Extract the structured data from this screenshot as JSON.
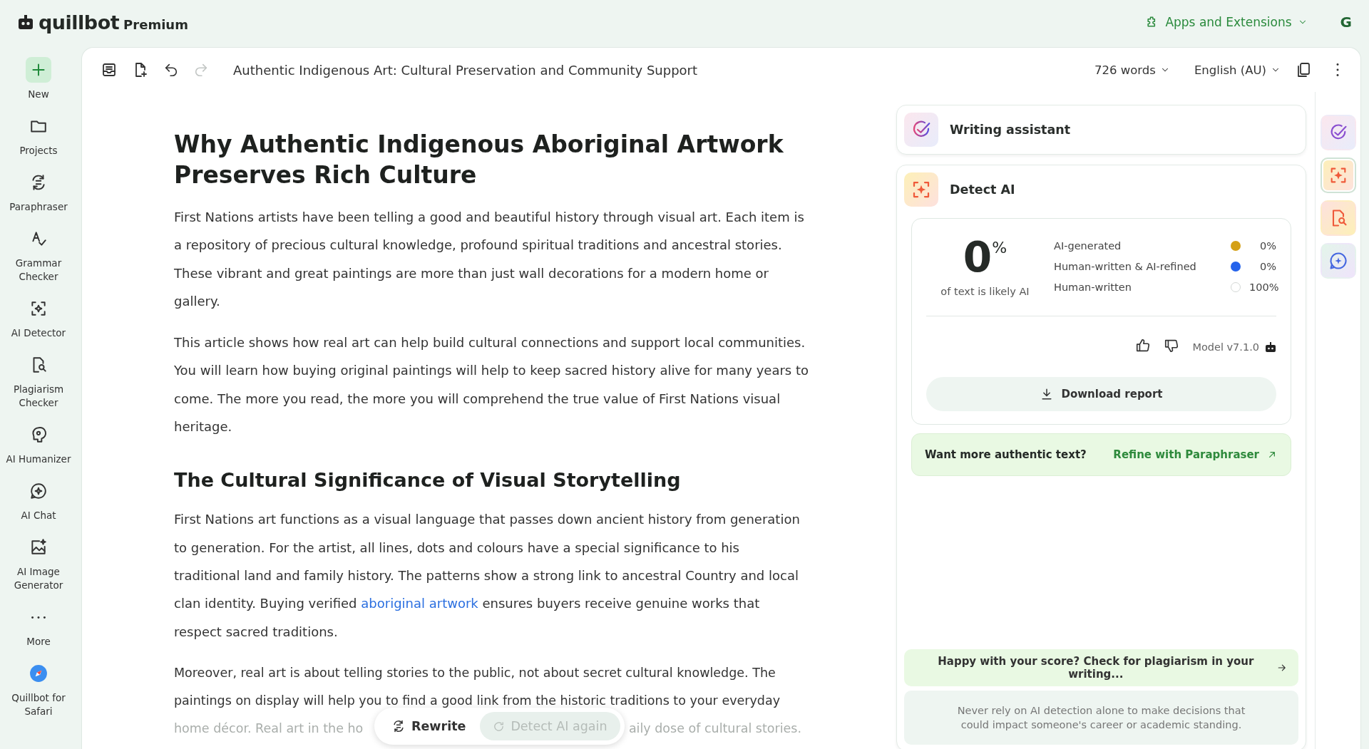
{
  "brand": {
    "name": "quillbot",
    "tier": "Premium"
  },
  "top_actions": {
    "apps_label": "Apps and Extensions",
    "avatar": "G"
  },
  "sidebar": {
    "items": [
      {
        "label": "New",
        "kind": "primary"
      },
      {
        "label": "Projects",
        "kind": "tool"
      },
      {
        "label": "Paraphraser",
        "kind": "tool"
      },
      {
        "label": "Grammar Checker",
        "kind": "tool"
      },
      {
        "label": "AI Detector",
        "kind": "tool"
      },
      {
        "label": "Plagiarism Checker",
        "kind": "tool"
      },
      {
        "label": "AI Humanizer",
        "kind": "tool"
      },
      {
        "label": "AI Chat",
        "kind": "tool"
      },
      {
        "label": "AI Image Generator",
        "kind": "tool"
      },
      {
        "label": "More",
        "kind": "tool"
      },
      {
        "label": "Quillbot for Safari",
        "kind": "app"
      }
    ]
  },
  "editor": {
    "title": "Authentic Indigenous Art: Cultural Preservation and Community Support",
    "word_count": "726 words",
    "language": "English (AU)",
    "redo_disabled": true,
    "blocks": [
      {
        "kind": "h1",
        "text": "Why Authentic Indigenous Aboriginal Artwork Preserves Rich Culture"
      },
      {
        "kind": "p",
        "text": "First Nations artists have been telling a good and beautiful history through visual art. Each item is a repository of precious cultural knowledge, profound spiritual traditions and ancestral stories. These vibrant and great paintings are more than just wall decorations for a modern home or gallery."
      },
      {
        "kind": "p",
        "text": "This article shows how real art can help build cultural connections and support local communities. You will learn how buying original paintings will help to keep sacred history alive for many years to come. The more you read, the more you will comprehend the true value of First Nations visual heritage."
      },
      {
        "kind": "h2",
        "text": "The Cultural Significance of Visual Storytelling"
      },
      {
        "kind": "p_link",
        "before": "First Nations art functions as a visual language that passes down ancient history from generation to generation. For the artist, all lines, dots and colours have a special significance to his traditional land and family history. The patterns show a strong link to ancestral Country and local clan identity. Buying verified ",
        "link": "aboriginal artwork",
        "after": " ensures buyers receive genuine works that respect sacred traditions."
      },
      {
        "kind": "cut",
        "lines": [
          "Moreover, real art is about telling stories to the public, not about secret cultural knowledge. The",
          "paintings on display will help you to find a good link from the historic traditions to your everyday"
        ],
        "faded": [
          "home décor. Real art in the ho",
          "aily dose of cultural stories."
        ]
      }
    ]
  },
  "floating_bar": {
    "rewrite": "Rewrite",
    "detect_again": {
      "label": "Detect AI again",
      "disabled": true
    }
  },
  "panel": {
    "writing_assistant": "Writing assistant",
    "detect_title": "Detect AI",
    "score": {
      "value": "0",
      "unit": "%",
      "caption": "of text is likely AI"
    },
    "breakdown": [
      {
        "label": "AI-generated",
        "color": "#d4a017",
        "value": "0%"
      },
      {
        "label": "Human-written & AI-refined",
        "color": "#2563eb",
        "value": "0%"
      },
      {
        "label": "Human-written",
        "color": "#ffffff",
        "value": "100%"
      }
    ],
    "model": "Model v7.1.0",
    "download": "Download report",
    "refine": {
      "prompt": "Want more authentic text?",
      "action": "Refine with Paraphraser"
    },
    "plagiarism_prompt": "Happy with your score? Check for plagiarism in your writing...",
    "disclaimer": "Never rely on AI detection alone to make decisions that could impact someone's career or academic standing."
  },
  "rail": [
    {
      "selected": false
    },
    {
      "selected": true
    },
    {
      "selected": false
    },
    {
      "selected": false
    }
  ]
}
